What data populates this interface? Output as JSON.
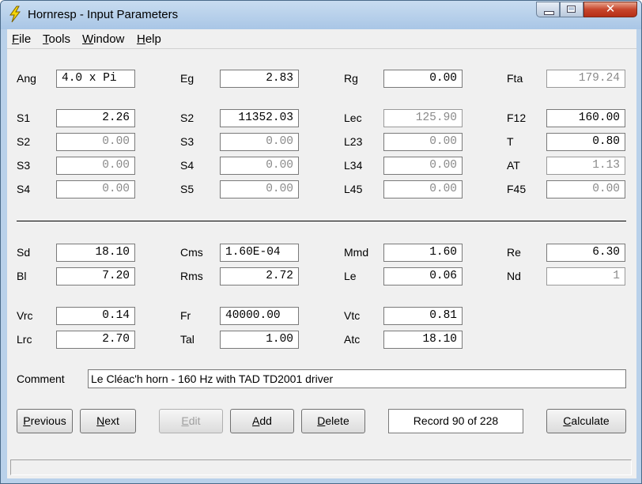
{
  "window": {
    "title": "Hornresp - Input Parameters",
    "close_glyph": "✕"
  },
  "menu": {
    "file": "File",
    "tools": "Tools",
    "window": "Window",
    "help": "Help"
  },
  "params": {
    "Ang": {
      "label": "Ang",
      "value": "4.0 x Pi"
    },
    "Eg": {
      "label": "Eg",
      "value": "2.83"
    },
    "Rg": {
      "label": "Rg",
      "value": "0.00"
    },
    "Fta": {
      "label": "Fta",
      "value": "179.24"
    },
    "S1": {
      "label": "S1",
      "value": "2.26"
    },
    "S2a": {
      "label": "S2",
      "value": "11352.03"
    },
    "Lec": {
      "label": "Lec",
      "value": "125.90"
    },
    "F12": {
      "label": "F12",
      "value": "160.00"
    },
    "S2b": {
      "label": "S2",
      "value": "0.00"
    },
    "S3a": {
      "label": "S3",
      "value": "0.00"
    },
    "L23": {
      "label": "L23",
      "value": "0.00"
    },
    "T": {
      "label": "T",
      "value": "0.80"
    },
    "S3b": {
      "label": "S3",
      "value": "0.00"
    },
    "S4a": {
      "label": "S4",
      "value": "0.00"
    },
    "L34": {
      "label": "L34",
      "value": "0.00"
    },
    "AT": {
      "label": "AT",
      "value": "1.13"
    },
    "S4b": {
      "label": "S4",
      "value": "0.00"
    },
    "S5": {
      "label": "S5",
      "value": "0.00"
    },
    "L45": {
      "label": "L45",
      "value": "0.00"
    },
    "F45": {
      "label": "F45",
      "value": "0.00"
    },
    "Sd": {
      "label": "Sd",
      "value": "18.10"
    },
    "Cms": {
      "label": "Cms",
      "value": "1.60E-04"
    },
    "Mmd": {
      "label": "Mmd",
      "value": "1.60"
    },
    "Re": {
      "label": "Re",
      "value": "6.30"
    },
    "Bl": {
      "label": "Bl",
      "value": "7.20"
    },
    "Rms": {
      "label": "Rms",
      "value": "2.72"
    },
    "Le": {
      "label": "Le",
      "value": "0.06"
    },
    "Nd": {
      "label": "Nd",
      "value": "1"
    },
    "Vrc": {
      "label": "Vrc",
      "value": "0.14"
    },
    "Fr": {
      "label": "Fr",
      "value": "40000.00"
    },
    "Vtc": {
      "label": "Vtc",
      "value": "0.81"
    },
    "Lrc": {
      "label": "Lrc",
      "value": "2.70"
    },
    "Tal": {
      "label": "Tal",
      "value": "1.00"
    },
    "Atc": {
      "label": "Atc",
      "value": "18.10"
    }
  },
  "comment": {
    "label": "Comment",
    "value": "Le Cléac'h horn - 160 Hz with TAD TD2001 driver"
  },
  "buttons": {
    "previous": "Previous",
    "next": "Next",
    "edit": "Edit",
    "add": "Add",
    "delete": "Delete",
    "calculate": "Calculate"
  },
  "record": "Record 90 of 228",
  "status": ""
}
